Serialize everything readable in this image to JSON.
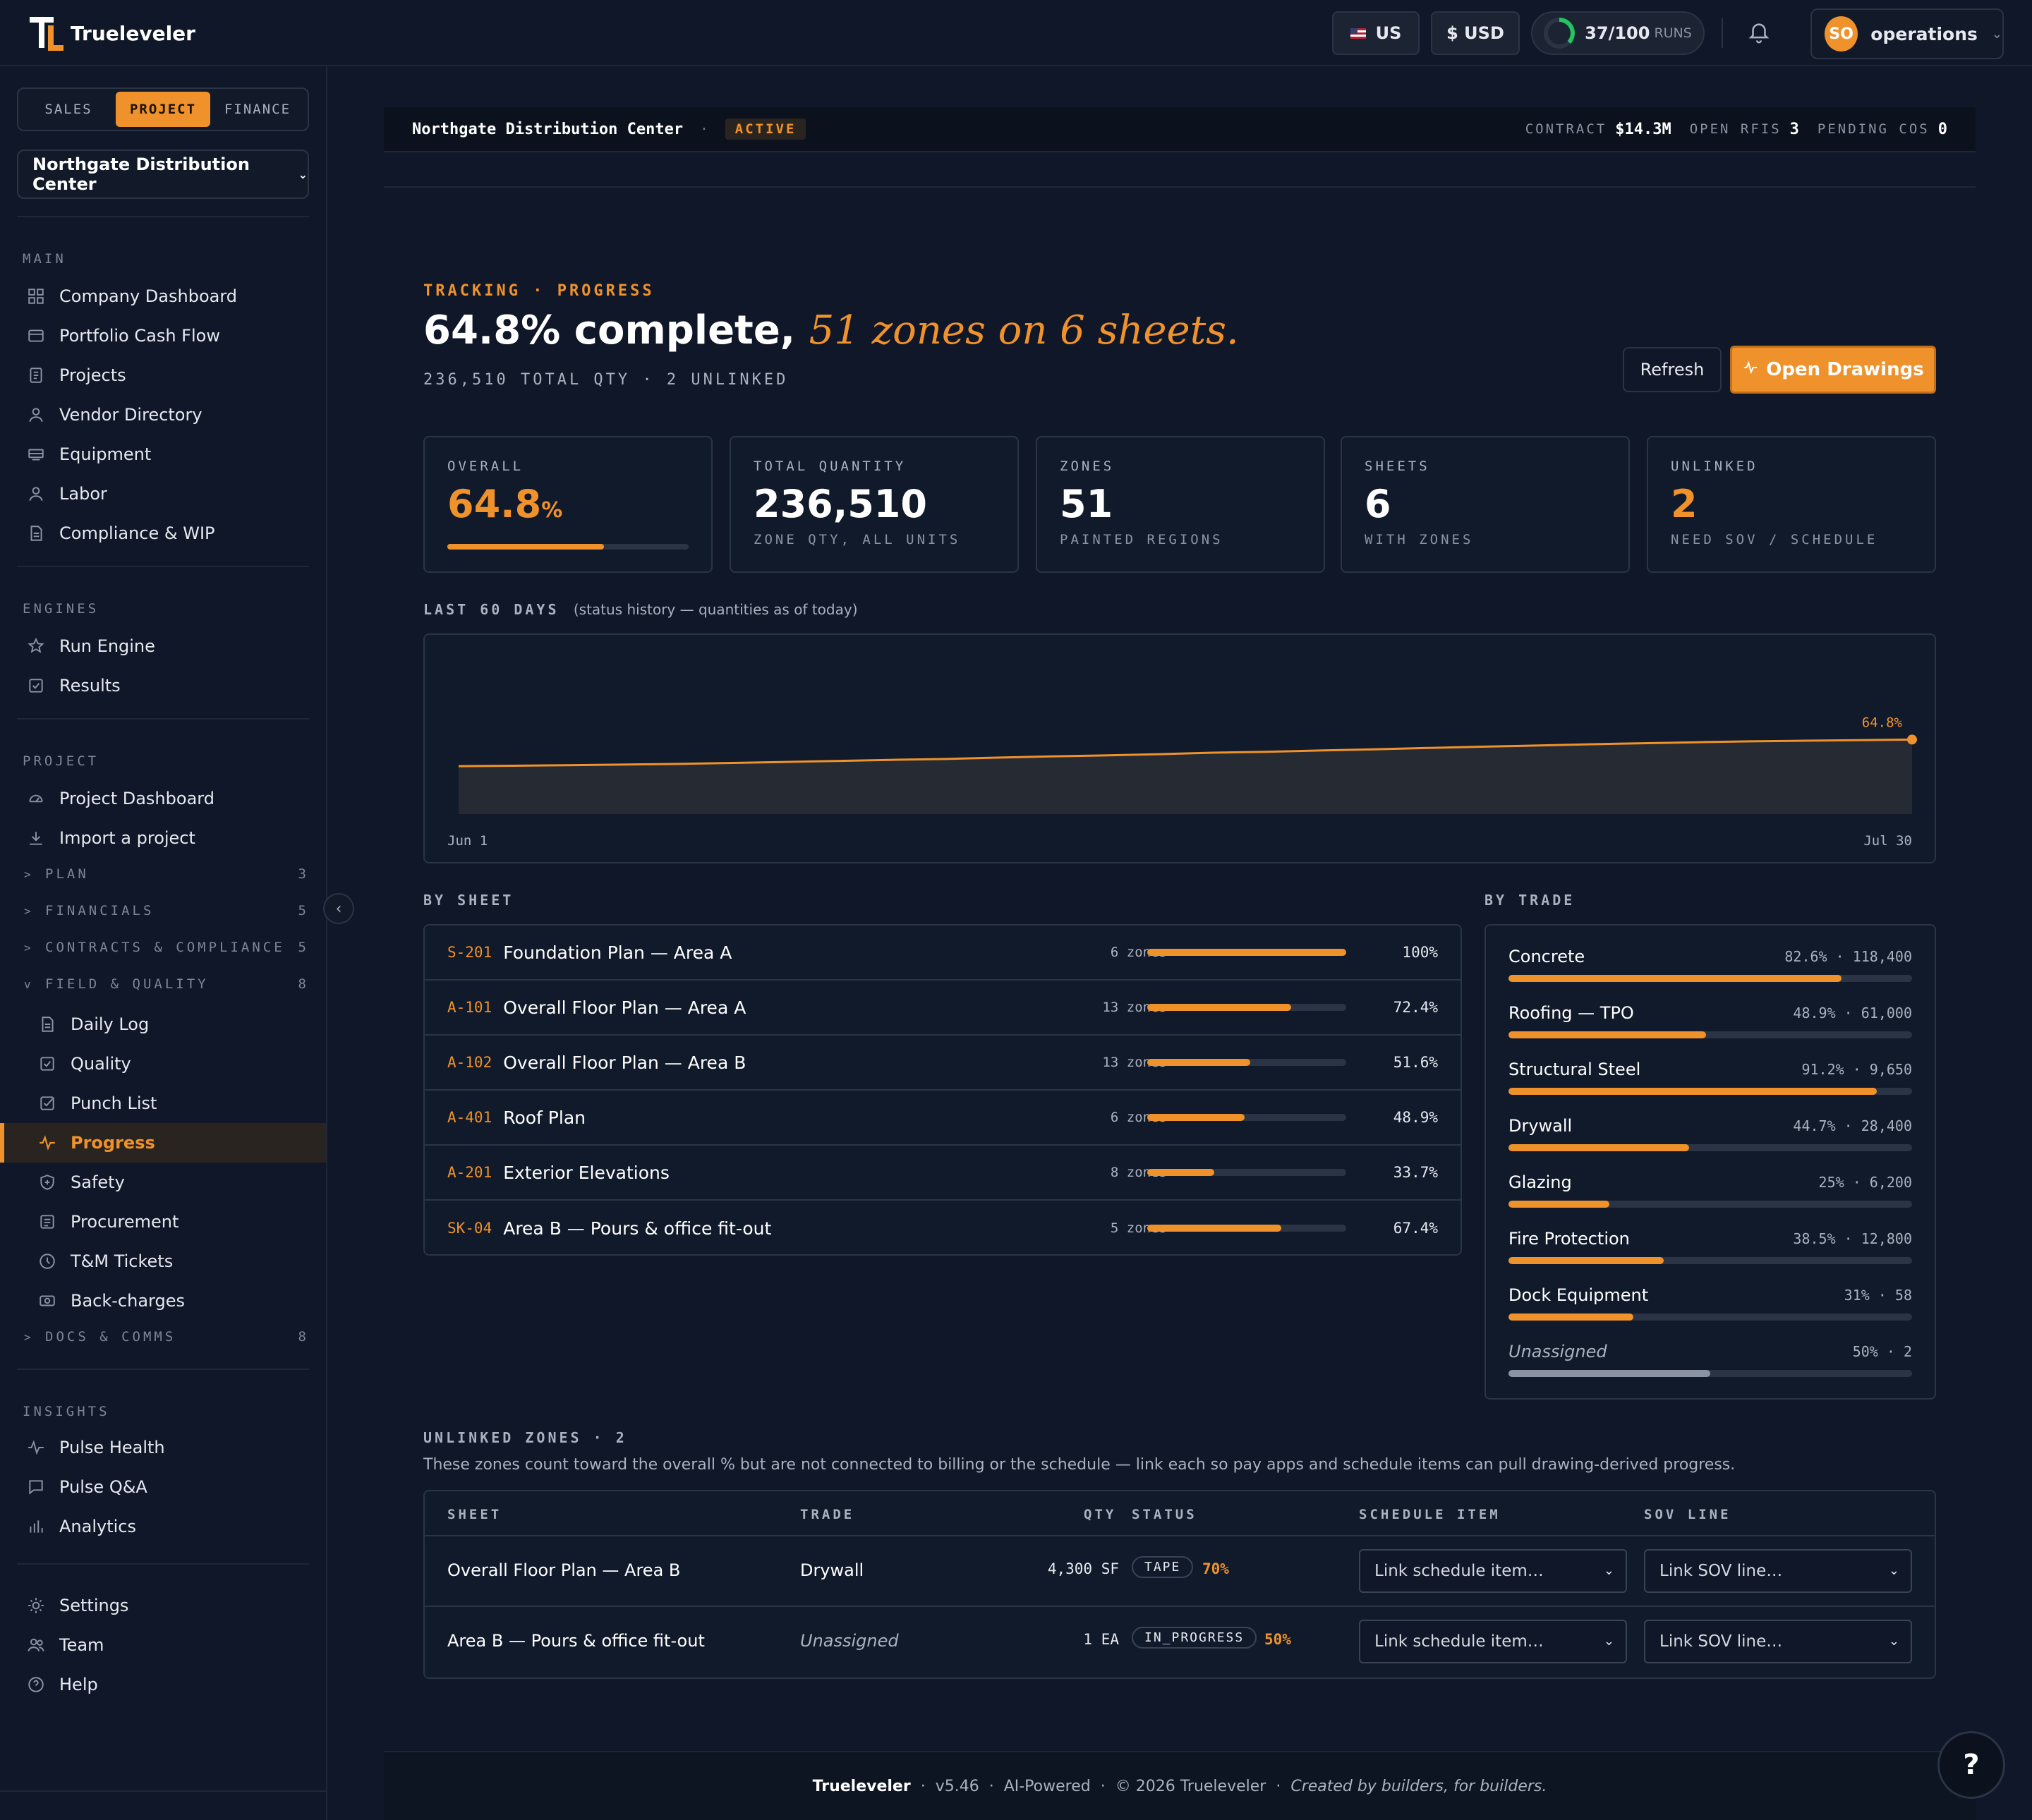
{
  "app": {
    "name": "Trueleveler"
  },
  "topbar": {
    "region": "US",
    "currency": "$ USD",
    "runs_value": "37/100",
    "runs_label": "RUNS",
    "runs_fraction": 0.37,
    "user_initials": "SO",
    "user_name": "operations"
  },
  "sidebar": {
    "tabs": [
      "SALES",
      "PROJECT",
      "FINANCE"
    ],
    "active_tab": "PROJECT",
    "project_select": "Northgate Distribution Center",
    "main_heading": "MAIN",
    "main_items": [
      "Company Dashboard",
      "Portfolio Cash Flow",
      "Projects",
      "Vendor Directory",
      "Equipment",
      "Labor",
      "Compliance & WIP"
    ],
    "engines_heading": "ENGINES",
    "engines_items": [
      "Run Engine",
      "Results"
    ],
    "project_heading": "PROJECT",
    "project_items": [
      "Project Dashboard",
      "Import a project"
    ],
    "groups": [
      {
        "label": "PLAN",
        "count": "3"
      },
      {
        "label": "FINANCIALS",
        "count": "5"
      },
      {
        "label": "CONTRACTS & COMPLIANCE",
        "count": "5"
      },
      {
        "label": "FIELD & QUALITY",
        "count": "8"
      },
      {
        "label": "DOCS & COMMS",
        "count": "8"
      }
    ],
    "field_items": [
      "Daily Log",
      "Quality",
      "Punch List",
      "Progress",
      "Safety",
      "Procurement",
      "T&M Tickets",
      "Back-charges"
    ],
    "active_item": "Progress",
    "insights_heading": "INSIGHTS",
    "insights_items": [
      "Pulse Health",
      "Pulse Q&A",
      "Analytics"
    ],
    "bottom_items": [
      "Settings",
      "Team",
      "Help"
    ]
  },
  "crumbbar": {
    "project": "Northgate Distribution Center",
    "status": "ACTIVE",
    "contract_label": "CONTRACT",
    "contract_value": "$14.3M",
    "rfis_label": "OPEN RFIS",
    "rfis_value": "3",
    "cos_label": "PENDING COS",
    "cos_value": "0"
  },
  "header": {
    "eyebrow": "TRACKING · PROGRESS",
    "headline_main": "64.8% complete,",
    "headline_em": "51 zones on 6 sheets.",
    "subline": "236,510 TOTAL QTY · 2 UNLINKED",
    "refresh_label": "Refresh",
    "open_label": "Open Drawings"
  },
  "kpis": [
    {
      "label": "OVERALL",
      "value": "64.8",
      "unit": "%",
      "fraction": 0.648
    },
    {
      "label": "TOTAL QUANTITY",
      "value": "236,510",
      "sub": "ZONE QTY, ALL UNITS"
    },
    {
      "label": "ZONES",
      "value": "51",
      "sub": "PAINTED REGIONS"
    },
    {
      "label": "SHEETS",
      "value": "6",
      "sub": "WITH ZONES"
    },
    {
      "label": "UNLINKED",
      "value": "2",
      "sub": "NEED SOV / SCHEDULE"
    }
  ],
  "history": {
    "label": "LAST 60 DAYS",
    "note": "(status history — quantities as of today)"
  },
  "chart_data": {
    "type": "area",
    "x_start": "Jun 1",
    "x_end": "Jul 30",
    "end_label": "64.8%",
    "ylim": [
      0,
      100
    ],
    "values": [
      48.0,
      48.3,
      48.6,
      49.0,
      49.4,
      50.0,
      50.6,
      51.3,
      52.0,
      52.5,
      53.4,
      54.2,
      54.8,
      55.6,
      56.5,
      57.1,
      57.9,
      58.6,
      59.5,
      60.3,
      61.0,
      61.8,
      62.5,
      63.1,
      63.7,
      64.1,
      64.4,
      64.8
    ]
  },
  "by_sheet": {
    "label": "BY SHEET",
    "rows": [
      {
        "code": "S-201",
        "name": "Foundation Plan — Area A",
        "zones": "6 zones",
        "pct_label": "100%",
        "pct": 100
      },
      {
        "code": "A-101",
        "name": "Overall Floor Plan — Area A",
        "zones": "13 zones",
        "pct_label": "72.4%",
        "pct": 72.4
      },
      {
        "code": "A-102",
        "name": "Overall Floor Plan — Area B",
        "zones": "13 zones",
        "pct_label": "51.6%",
        "pct": 51.6
      },
      {
        "code": "A-401",
        "name": "Roof Plan",
        "zones": "6 zones",
        "pct_label": "48.9%",
        "pct": 48.9
      },
      {
        "code": "A-201",
        "name": "Exterior Elevations",
        "zones": "8 zones",
        "pct_label": "33.7%",
        "pct": 33.7
      },
      {
        "code": "SK-04",
        "name": "Area B — Pours & office fit-out",
        "zones": "5 zones",
        "pct_label": "67.4%",
        "pct": 67.4
      }
    ]
  },
  "by_trade": {
    "label": "BY TRADE",
    "rows": [
      {
        "name": "Concrete",
        "value": "82.6% · 118,400",
        "pct": 82.6
      },
      {
        "name": "Roofing — TPO",
        "value": "48.9% · 61,000",
        "pct": 48.9
      },
      {
        "name": "Structural Steel",
        "value": "91.2% · 9,650",
        "pct": 91.2
      },
      {
        "name": "Drywall",
        "value": "44.7% · 28,400",
        "pct": 44.7
      },
      {
        "name": "Glazing",
        "value": "25% · 6,200",
        "pct": 25
      },
      {
        "name": "Fire Protection",
        "value": "38.5% · 12,800",
        "pct": 38.5
      },
      {
        "name": "Dock Equipment",
        "value": "31% · 58",
        "pct": 31
      },
      {
        "name": "Unassigned",
        "value": "50% · 2",
        "pct": 50,
        "unassigned": true
      }
    ]
  },
  "unlinked": {
    "label": "UNLINKED ZONES · 2",
    "description": "These zones count toward the overall % but are not connected to billing or the schedule — link each so pay apps and schedule items can pull drawing-derived progress.",
    "columns": [
      "SHEET",
      "TRADE",
      "QTY",
      "STATUS",
      "SCHEDULE ITEM",
      "SOV LINE"
    ],
    "rows": [
      {
        "sheet": "Overall Floor Plan — Area B",
        "trade": "Drywall",
        "qty": "4,300 SF",
        "status": "TAPE",
        "pct": "70%",
        "schedule": "Link schedule item…",
        "sov": "Link SOV line…"
      },
      {
        "sheet": "Area B — Pours & office fit-out",
        "trade": "Unassigned",
        "qty": "1 EA",
        "status": "IN_PROGRESS",
        "pct": "50%",
        "schedule": "Link schedule item…",
        "sov": "Link SOV line…",
        "trade_unassigned": true
      }
    ]
  },
  "footer": {
    "brand": "Trueleveler",
    "version": "v5.46",
    "ai": "AI-Powered",
    "copyright": "© 2026 Trueleveler",
    "tagline": "Created by builders, for builders."
  },
  "help_fab": "?",
  "colors": {
    "accent": "#f0922b",
    "background": "#0f1728",
    "card": "#111a2b",
    "runs_ring": "#22c55e"
  }
}
